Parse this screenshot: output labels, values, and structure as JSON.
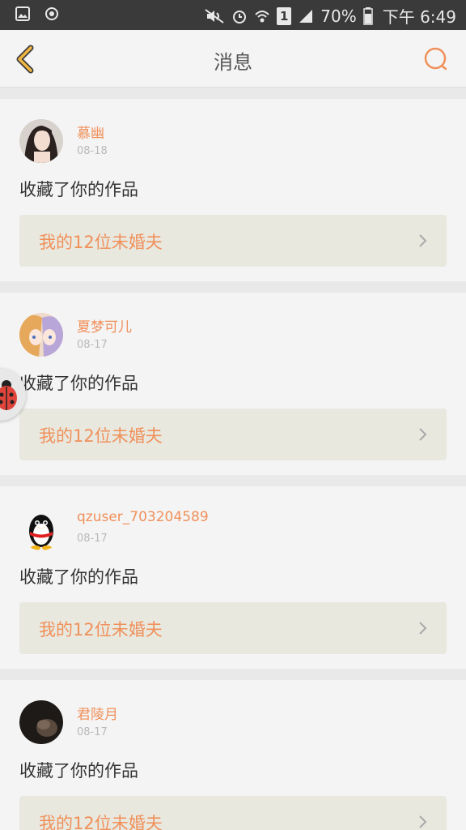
{
  "status_bar": {
    "battery": "70%",
    "time": "下午 6:49",
    "sim_label": "1",
    "icons": [
      "image-icon",
      "circle-icon",
      "mute-icon",
      "alarm-icon",
      "wifi-icon",
      "sim-icon",
      "signal-icon",
      "battery-icon"
    ]
  },
  "header": {
    "title": "消息",
    "back_icon": "chevron-left-icon",
    "search_icon": "search-icon"
  },
  "messages": [
    {
      "user": "慕幽",
      "date": "08-18",
      "action": "收藏了你的作品",
      "work_title": "我的12位未婚夫",
      "avatar": "avatar-girl"
    },
    {
      "user": "夏梦可儿",
      "date": "08-17",
      "action": "收藏了你的作品",
      "work_title": "我的12位未婚夫",
      "avatar": "avatar-anime"
    },
    {
      "user": "qzuser_703204589",
      "date": "08-17",
      "action": "收藏了你的作品",
      "work_title": "我的12位未婚夫",
      "avatar": "avatar-penguin"
    },
    {
      "user": "君陵月",
      "date": "08-17",
      "action": "收藏了你的作品",
      "work_title": "我的12位未婚夫",
      "avatar": "avatar-dark"
    }
  ],
  "floating_button": {
    "icon": "ladybug-icon"
  },
  "colors": {
    "accent": "#f0905a",
    "header_icon": "#f0b642",
    "status_bar": "#3a3a3a",
    "card_link_bg": "#e8e8df"
  }
}
